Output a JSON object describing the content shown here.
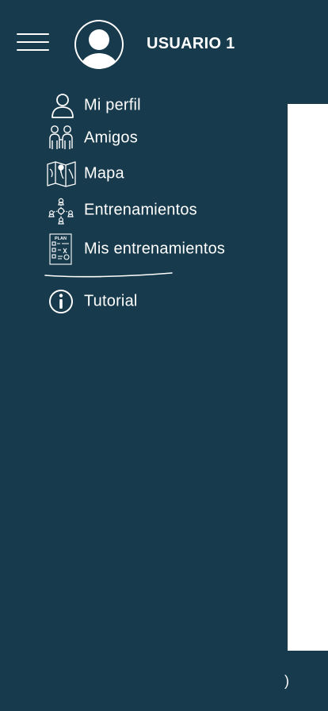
{
  "header": {
    "username": "USUARIO 1",
    "menu_icon": "hamburger-menu-icon",
    "avatar_icon": "user-avatar-icon"
  },
  "nav": {
    "items": [
      {
        "label": "Mi perfil",
        "icon": "user-outline-icon"
      },
      {
        "label": "Amigos",
        "icon": "friends-icon"
      },
      {
        "label": "Mapa",
        "icon": "map-icon"
      },
      {
        "label": "Entrenamientos",
        "icon": "training-network-icon"
      },
      {
        "label": "Mis entrenamientos",
        "icon": "plan-checklist-icon",
        "icon_text": "PLAN"
      },
      {
        "label": "Tutorial",
        "icon": "info-icon"
      }
    ]
  },
  "footer": {
    "glyph": "⁀"
  },
  "colors": {
    "background": "#173a4c",
    "foreground": "#ffffff",
    "content_panel": "#ffffff"
  }
}
